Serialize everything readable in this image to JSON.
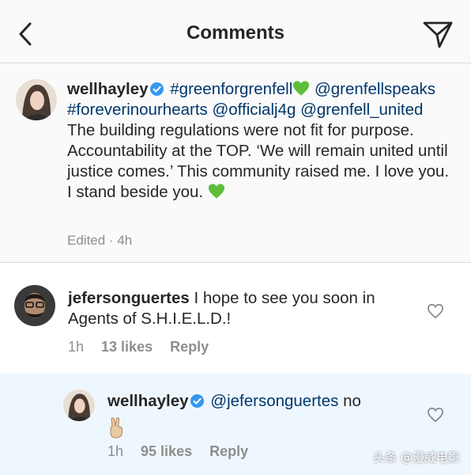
{
  "header": {
    "title": "Comments",
    "back_icon": "chevron-left-icon",
    "send_icon": "paper-plane-icon"
  },
  "caption": {
    "username": "wellhayley",
    "verified": true,
    "hashtag1": "#greenforgrenfell",
    "mention1": "@grenfellspeaks",
    "hashtag2": "#foreverinourhearts",
    "mention2": "@officialj4g",
    "mention3": "@grenfell_united",
    "body": "The building regulations were not fit for purpose. Accountability at the TOP. ‘We will remain united until justice comes.’ This community raised me. I love you. I stand beside you.",
    "edited": "Edited",
    "time": "4h"
  },
  "comments": [
    {
      "username": "jefersonguertes",
      "text": "I hope to see you soon in Agents of S.H.I.E.L.D.!",
      "time": "1h",
      "likes": "13 likes",
      "reply": "Reply"
    },
    {
      "username": "wellhayley",
      "verified": true,
      "mention": "@jefersonguertes",
      "text": "no",
      "emoji": "victory-hand-emoji",
      "time": "1h",
      "likes": "95 likes",
      "reply": "Reply"
    }
  ],
  "watermark": "头条 @漫威电影",
  "colors": {
    "link": "#00376b",
    "verified": "#3897f0",
    "heart": "#5cbf3a",
    "highlight_bg": "#eff7fe",
    "meta_gray": "#8e8e8e"
  }
}
